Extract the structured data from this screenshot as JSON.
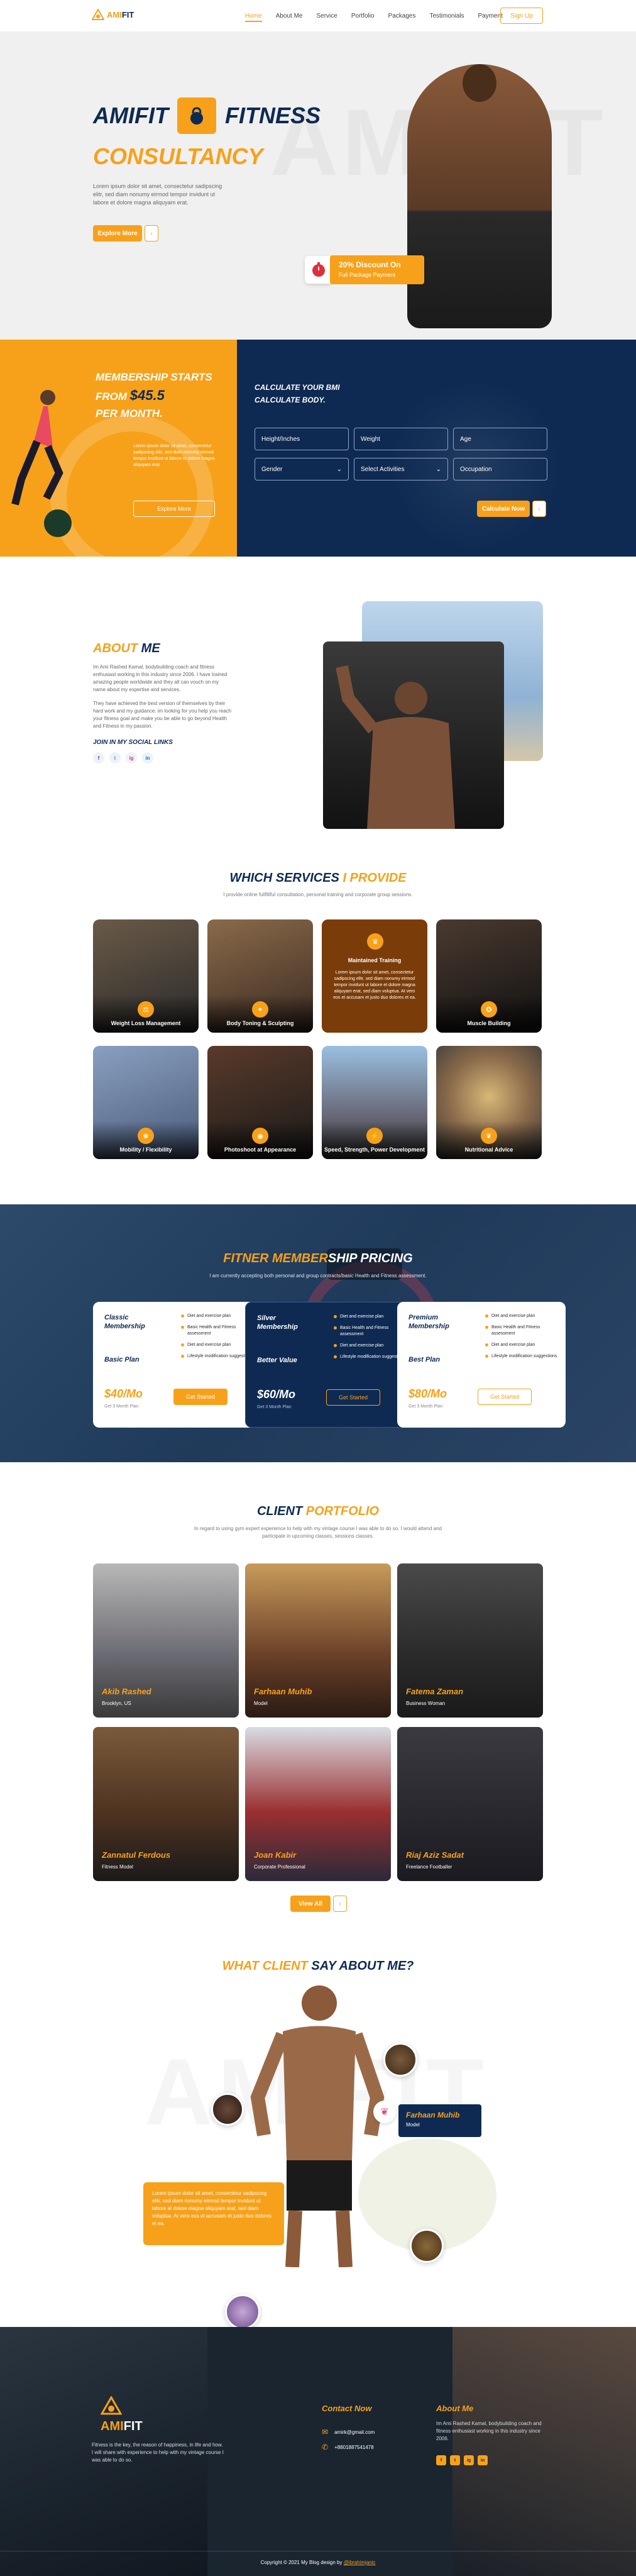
{
  "brand": {
    "name_a": "AMI",
    "name_b": "FIT"
  },
  "nav": {
    "items": [
      "Home",
      "About Me",
      "Service",
      "Portfolio",
      "Packages",
      "Testimonials",
      "Payment"
    ],
    "signup": "Sign Up"
  },
  "hero": {
    "line1": "AMIFIT",
    "line2": "FITNESS",
    "line3": "CONSULTANCY",
    "body": "Lorem ipsum dolor sit amet, consectetur sadipscing elitr, sed diam nonumy eirmod tempor invidunt ut labore et dolore magna aliquyam erat.",
    "cta": "Explore More",
    "cta_arrow": "›",
    "badge_title": "20% Discount On",
    "badge_sub": "Full Package Payment"
  },
  "membership": {
    "line1": "MEMBERSHIP STARTS",
    "line2a": "FROM ",
    "price": "$45.5",
    "line3": "PER MONTH.",
    "body": "Lorem ipsum dolor sit amet, consectetur sadipscing elitr, sed diam nonumy eirmod tempor invidunt ut labore et dolore magna aliquyam erat.",
    "cta": "Explore More"
  },
  "calc": {
    "title1": "CALCULATE YOUR BMI",
    "title2": "CALCULATE BODY.",
    "f1": "Height/Inches",
    "f2": "Weight",
    "f3": "Age",
    "f4": "Gender",
    "f5": "Select Activities",
    "f6": "Occupation",
    "cta": "Calculate Now",
    "arrow": "›"
  },
  "about": {
    "t_a": "ABOUT",
    "t_b": " ME",
    "p1": "Im Ami Rashed Kamal, bodybuilding coach and fitness enthusiast working in this industry since 2006. I have trained amazing people worldwide and they all can vouch on my name about my expertise and services.",
    "p2": "They have achieved the best version of themselves by their hard work and my guidance. im looking for you help you reach your fitness goal and make you be able to go beyond Health and Fitness in my passion.",
    "social_title": "JOIN IN MY SOCIAL LINKS",
    "social": [
      "f",
      "t",
      "ig",
      "in"
    ]
  },
  "services": {
    "t_a": "WHICH SERVICES ",
    "t_b": "I PROVIDE",
    "sub": "I provide online fullfillful consultation, personal training and corporate group sessions.",
    "items": [
      "Weight Loss Management",
      "Body Toning & Sculpting",
      "Maintained Training",
      "Muscle Building",
      "Mobility / Flexibility",
      "Photoshoot at Appearance",
      "Speed, Strength, Power Development",
      "Nutritional Advice"
    ],
    "maint_body": "Lorem ipsum dolor sit amet, consectetur sadipscing elitr, sed diam nonumy eirmod tempor invidunt ut labore et dolore magna aliquyam erat, sed diam voluptua. At vero eos et accusam et justo duo dolores et ea."
  },
  "pricing": {
    "t_a": "FITNER MEMBER",
    "t_b": "SHIP PRICING",
    "sub": "I am currently accepting both personal and group contracts/basic Health and Fitness assessment.",
    "plans": [
      {
        "name1": "Classic",
        "name2": "Membership",
        "plan": "Basic Plan",
        "price": "$40/Mo",
        "per": "Get 3 Month Plan",
        "cta": "Get Started",
        "feats": [
          "Diet and exercise plan",
          "Basic Health and Fitness assessment",
          "Diet and exercise plan",
          "Lifestyle modification suggestions"
        ]
      },
      {
        "name1": "Silver",
        "name2": "Membership",
        "plan": "Better Value",
        "price": "$60/Mo",
        "per": "Get 3 Month Plan",
        "cta": "Get Started",
        "feats": [
          "Diet and exercise plan",
          "Basic Health and Fitness assessment",
          "Diet and exercise plan",
          "Lifestyle modification suggestions"
        ]
      },
      {
        "name1": "Premium",
        "name2": "Membership",
        "plan": "Best Plan",
        "price": "$80/Mo",
        "per": "Get 3 Month Plan",
        "cta": "Get Started",
        "feats": [
          "Diet and exercise plan",
          "Basic Health and Fitness assessment",
          "Diet and exercise plan",
          "Lifestyle modification suggestions"
        ]
      }
    ]
  },
  "portfolio": {
    "t_a": "CLIENT ",
    "t_b": "PORTFOLIO",
    "sub": "In regard to using gym expert experience to help with my vintage course I was able to do so. I would attend and participate in upcoming classes, sessions classes.",
    "items": [
      {
        "name": "Akib Rashed",
        "role": "Brooklyn, US"
      },
      {
        "name": "Farhaan Muhib",
        "role": "Model"
      },
      {
        "name": "Fatema Zaman",
        "role": "Business Woman"
      },
      {
        "name": "Zannatul Ferdous",
        "role": "Fitness Model"
      },
      {
        "name": "Joan Kabir",
        "role": "Corporate Professional"
      },
      {
        "name": "Riaj Aziz Sadat",
        "role": "Freelance Footballer"
      }
    ],
    "cta": "View All",
    "arrow": "›"
  },
  "testimonial": {
    "t_a": "WHAT CLIENT ",
    "t_b": "SAY ABOUT ME?",
    "watermark": "AMIFIT",
    "quote": "Lorem ipsum dolor sit amet, consectetur sadipscing elitr, sed diam nonumy eirmod tempor invidunt ut labore et dolore magna aliquyam erat, sed diam voluptua. At vero eos et accusam et justo duo dolores et ea.",
    "name": "Farhaan Muhib",
    "role": "Model"
  },
  "footer": {
    "brand_a": "AMI",
    "brand_b": "FIT",
    "body": "Fitness is the key, the reason of happiness, in life and how. I will share with experience to help with my vintage course I was able to do so.",
    "contact_title": "Contact Now",
    "email": "amirk@gmail.com",
    "phone": "+8801887541478",
    "about_title": "About Me",
    "about_body": "Im Ami Rashed Kamal, bodybuilding coach and fitness enthusiast working in this industry since 2006.",
    "social": [
      "f",
      "t",
      "ig",
      "in"
    ],
    "copyright_a": "Copyright © 2021 My Blog design by ",
    "copyright_b": "@ibrahimjanic"
  },
  "colors": {
    "accent": "#f7a11a",
    "navy": "#0e2a52"
  }
}
